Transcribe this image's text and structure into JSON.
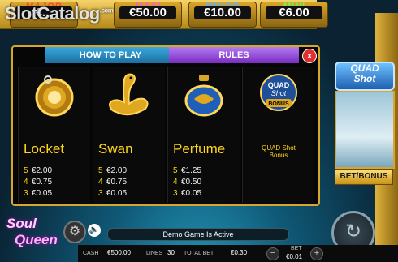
{
  "watermark": {
    "text": "SlotCatalog",
    "suffix": ".com"
  },
  "jackpots": [
    {
      "name": "MAJOR",
      "value": "€..."
    },
    {
      "name": "MAXI",
      "value": "€50.00"
    },
    {
      "name": "MINOR",
      "value": "€10.00"
    },
    {
      "name": "MINI",
      "value": "€6.00"
    }
  ],
  "dialog": {
    "tabs": {
      "how_to_play": "HOW TO PLAY",
      "rules": "RULES"
    },
    "close_label": "x",
    "symbols": [
      {
        "name": "Locket",
        "icon": "locket-icon",
        "pays": [
          {
            "count": "5",
            "value": "€2.00"
          },
          {
            "count": "4",
            "value": "€0.75"
          },
          {
            "count": "3",
            "value": "€0.05"
          }
        ]
      },
      {
        "name": "Swan",
        "icon": "swan-icon",
        "pays": [
          {
            "count": "5",
            "value": "€2.00"
          },
          {
            "count": "4",
            "value": "€0.75"
          },
          {
            "count": "3",
            "value": "€0.05"
          }
        ]
      },
      {
        "name": "Perfume",
        "icon": "perfume-icon",
        "pays": [
          {
            "count": "5",
            "value": "€1.25"
          },
          {
            "count": "4",
            "value": "€0.50"
          },
          {
            "count": "3",
            "value": "€0.05"
          }
        ]
      }
    ],
    "bonus": {
      "icon_text_1": "QUAD",
      "icon_text_2": "Shot",
      "icon_text_3": "BONUS",
      "description_1": "QUAD Shot",
      "description_2": "Bonus"
    }
  },
  "side_panel": {
    "quad_1": "QUAD",
    "quad_2": "Shot",
    "bet_bonus": "BET/BONUS"
  },
  "logo": {
    "line1": "Soul",
    "line2": "Queen"
  },
  "message": "Demo Game Is Active",
  "bottom": {
    "cash_label": "CASH",
    "cash_value": "€500.00",
    "lines_label": "LINES",
    "lines_value": "30",
    "total_bet_label": "TOTAL BET",
    "total_bet_value": "€0.30",
    "bet_label": "BET",
    "bet_value": "€0.01",
    "minus": "−",
    "plus": "+"
  },
  "colors": {
    "gold": "#f3c640",
    "rules_tab": "#8b3fd6",
    "how_to_play_tab": "#2a8fc6",
    "symbol_text": "#ffd51a"
  }
}
